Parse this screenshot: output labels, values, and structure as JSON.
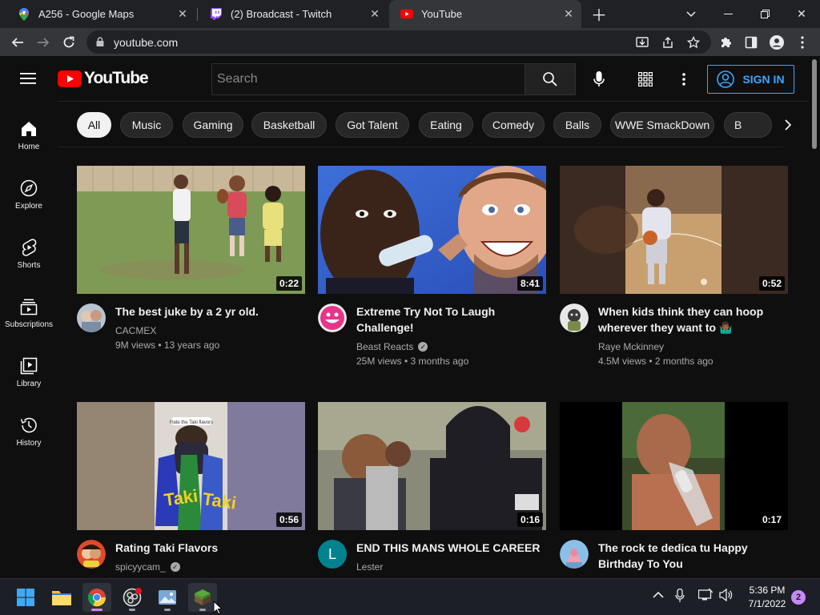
{
  "browser": {
    "tabs": [
      {
        "title": "A256 - Google Maps",
        "icon": "google-maps-icon"
      },
      {
        "title": "(2) Broadcast - Twitch",
        "icon": "twitch-icon"
      },
      {
        "title": "YouTube",
        "icon": "youtube-icon",
        "active": true
      }
    ],
    "url": "youtube.com"
  },
  "header": {
    "logo_text": "YouTube",
    "search_placeholder": "Search",
    "signin_label": "SIGN IN",
    "accent": "#3ea6ff",
    "brand_red": "#ff0000"
  },
  "sidebar": {
    "items": [
      {
        "label": "Home",
        "icon": "home-icon"
      },
      {
        "label": "Explore",
        "icon": "compass-icon"
      },
      {
        "label": "Shorts",
        "icon": "shorts-icon"
      },
      {
        "label": "Subscriptions",
        "icon": "subscriptions-icon"
      },
      {
        "label": "Library",
        "icon": "library-icon"
      },
      {
        "label": "History",
        "icon": "history-icon"
      }
    ]
  },
  "chips": [
    "All",
    "Music",
    "Gaming",
    "Basketball",
    "Got Talent",
    "Eating",
    "Comedy",
    "Balls",
    "WWE SmackDown",
    "B"
  ],
  "videos": [
    {
      "title": "The best juke by a 2 yr old.",
      "channel": "CACMEX",
      "verified": false,
      "meta": "9M views • 13 years ago",
      "duration": "0:22"
    },
    {
      "title": "Extreme Try Not To Laugh Challenge!",
      "channel": "Beast Reacts",
      "verified": true,
      "meta": "25M views • 3 months ago",
      "duration": "8:41"
    },
    {
      "title": "When kids think they can hoop wherever they want to 🤷🏾‍♂️",
      "channel": "Raye Mckinney",
      "verified": false,
      "meta": "4.5M views • 2 months ago",
      "duration": "0:52"
    },
    {
      "title": "Rating Taki Flavors",
      "channel": "spicyycam_",
      "verified": true,
      "meta": "",
      "duration": "0:56"
    },
    {
      "title": "END THIS MANS WHOLE CAREER",
      "channel": "Lester",
      "verified": false,
      "meta": "",
      "duration": "0:16",
      "avatar_letter": "L"
    },
    {
      "title": "The rock te dedica tu Happy Birthday To You",
      "channel": "",
      "verified": false,
      "meta": "",
      "duration": "0:17"
    }
  ],
  "thumb_text": {
    "taki_caption": "Rate the Taki flavors",
    "taki_brand": "Taki"
  },
  "taskbar": {
    "time": "5:36 PM",
    "date": "7/1/2022",
    "notifications": "2"
  }
}
